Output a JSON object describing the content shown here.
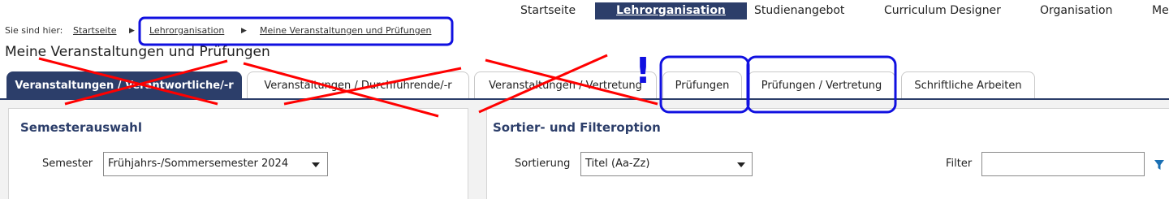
{
  "nav": {
    "items": [
      "Startseite",
      "Lehrorganisation",
      "Studienangebot",
      "Curriculum Designer",
      "Organisation",
      "Me"
    ],
    "active": "Lehrorganisation"
  },
  "breadcrumb": {
    "prefix": "Sie sind hier:",
    "items": [
      "Startseite",
      "Lehrorganisation",
      "Meine Veranstaltungen und Prüfungen"
    ],
    "separator": "›"
  },
  "page": {
    "title": "Meine Veranstaltungen und Prüfungen"
  },
  "tabs": [
    "Veranstaltungen / Verantwortliche/-r",
    "Veranstaltungen / Durchführende/-r",
    "Veranstaltungen / Vertretung",
    "Prüfungen",
    "Prüfungen / Vertretung",
    "Schriftliche Arbeiten"
  ],
  "semester_panel": {
    "title": "Semesterauswahl",
    "semester_label": "Semester",
    "semester_value": "Frühjahrs-/Sommersemester 2024"
  },
  "sort_panel": {
    "title": "Sortier- und Filteroption",
    "sort_label": "Sortierung",
    "sort_value": "Titel (Aa-Zz)",
    "filter_label": "Filter",
    "filter_value": ""
  },
  "annotations": {
    "exclamation": "!"
  },
  "colors": {
    "primary": "#2c3e6a",
    "annotation_blue": "#1010e0",
    "annotation_red": "#ff0000",
    "filter_icon": "#1a6fb3"
  }
}
